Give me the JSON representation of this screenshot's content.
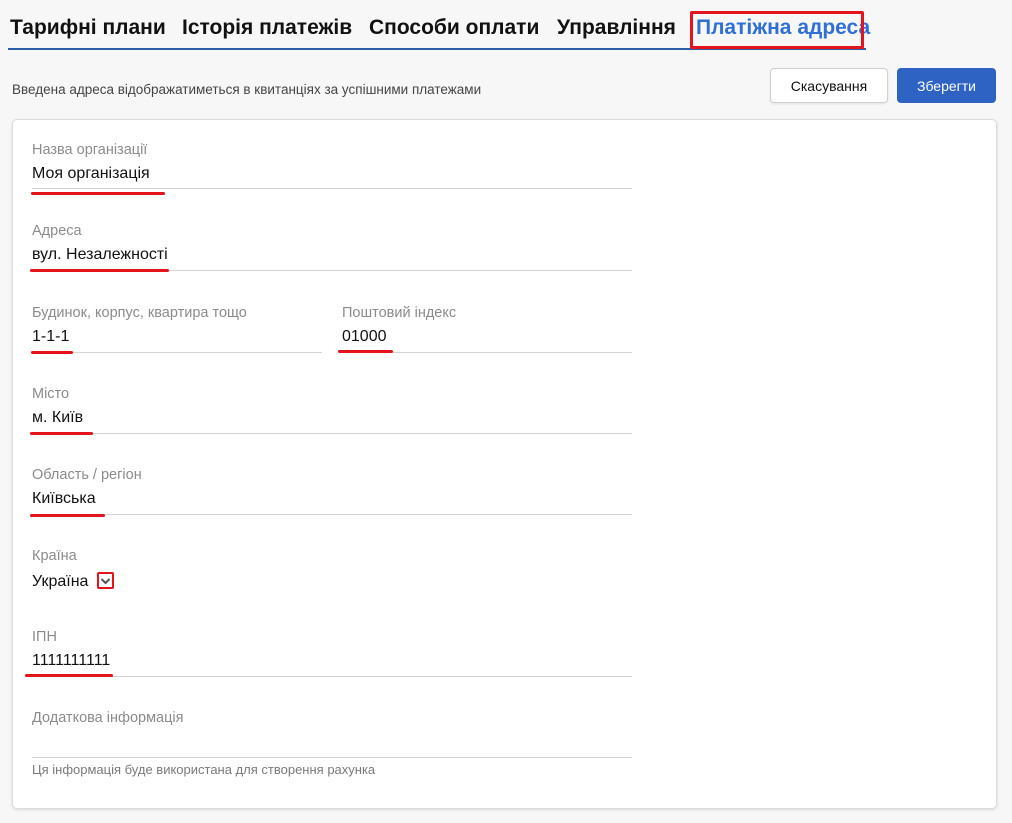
{
  "tabs": [
    {
      "label": "Тарифні плани"
    },
    {
      "label": "Історія платежів"
    },
    {
      "label": "Способи оплати"
    },
    {
      "label": "Управління"
    },
    {
      "label": "Платіжна адреса",
      "active": true
    }
  ],
  "toolbar": {
    "hint": "Введена адреса відображатиметься в квитанціях за успішними платежами",
    "cancel_label": "Скасування",
    "save_label": "Зберегти"
  },
  "form": {
    "org_name": {
      "label": "Назва організації",
      "value": "Моя організація"
    },
    "address": {
      "label": "Адреса",
      "value": "вул. Незалежності"
    },
    "building": {
      "label": "Будинок, корпус, квартира тощо",
      "value": "1-1-1"
    },
    "postal_code": {
      "label": "Поштовий індекс",
      "value": "01000"
    },
    "city": {
      "label": "Місто",
      "value": "м. Київ"
    },
    "region": {
      "label": "Область / регіон",
      "value": "Київська"
    },
    "country": {
      "label": "Країна",
      "value": "Україна"
    },
    "tax_id": {
      "label": "ІПН",
      "value": "1111111111"
    },
    "extra_info": {
      "label": "Додаткова інформація",
      "value": "",
      "help": "Ця інформація буде використана для створення рахунка"
    }
  },
  "colors": {
    "accent": "#2e63c4",
    "active_tab": "#2f6fd6",
    "annotation": "#e3141b"
  }
}
